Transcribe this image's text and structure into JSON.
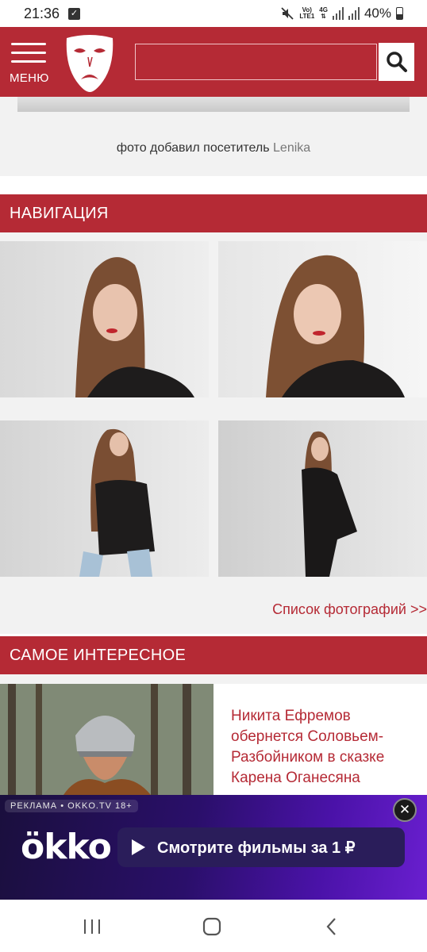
{
  "status_bar": {
    "time": "21:36",
    "volte_top": "Vo)",
    "volte_bottom": "LTE1",
    "network": "4G",
    "battery": "40%",
    "icons": [
      "check-icon",
      "mute-icon",
      "signal-icon",
      "battery-icon"
    ]
  },
  "header": {
    "menu_label": "МЕНЮ",
    "search_placeholder": "",
    "brand_color": "#b52a35",
    "icons": [
      "menu-icon",
      "theater-mask-logo",
      "search-icon"
    ]
  },
  "photo_credit": {
    "prefix": "фото добавил посетитель",
    "user": "Lenika"
  },
  "navigation": {
    "title": "НАВИГАЦИЯ",
    "list_link": "Список фотографий >>",
    "thumbnails": [
      "photo-thumb-1",
      "photo-thumb-2",
      "photo-thumb-3",
      "photo-thumb-4"
    ]
  },
  "interesting": {
    "title": "САМОЕ ИНТЕРЕСНОЕ",
    "news_title": "Никита Ефремов обернется Соловьем-Разбойником в сказке Карена Оганесяна"
  },
  "ad": {
    "label": "РЕКЛАМА • OKKO.TV 18+",
    "logo": "ökko",
    "button_label": "Смотрите фильмы за 1 ₽",
    "close_symbol": "✕"
  },
  "system_nav": {
    "icons": [
      "recent-apps-icon",
      "home-icon",
      "back-icon"
    ]
  }
}
